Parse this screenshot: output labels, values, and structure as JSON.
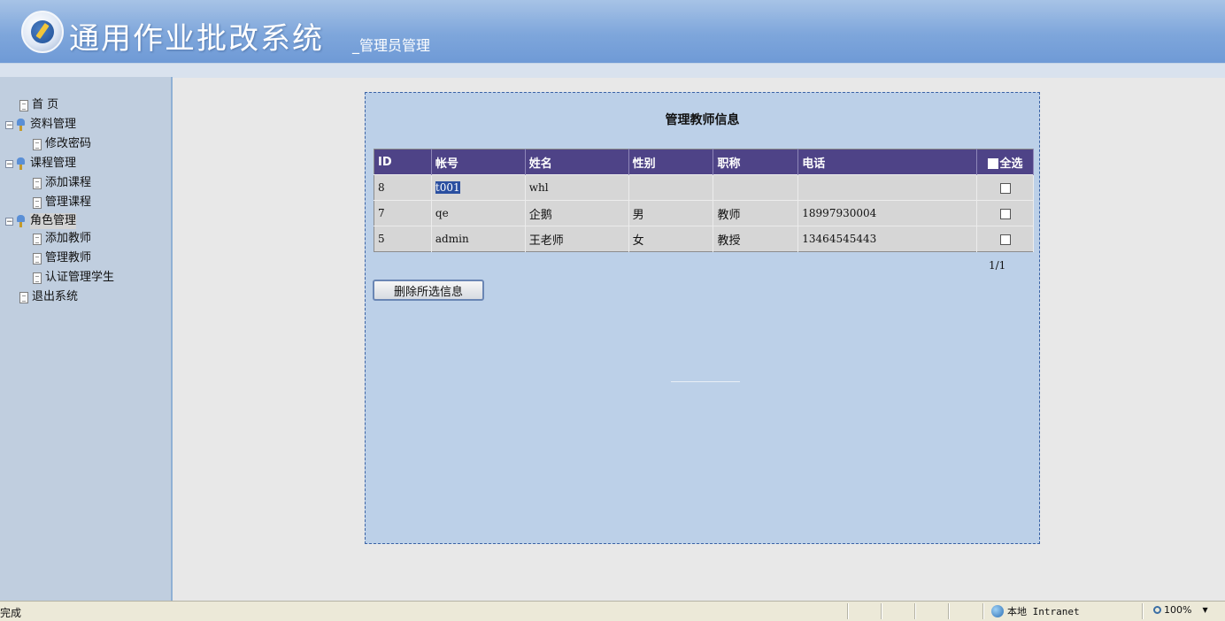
{
  "header": {
    "title": "通用作业批改系统",
    "subtitle": "_管理员管理"
  },
  "sidebar": {
    "items": [
      {
        "label": "首 页",
        "icon": "page-icon",
        "level": 0,
        "expander": ""
      },
      {
        "label": "资料管理",
        "icon": "folder-icon",
        "level": 0,
        "expander": "−"
      },
      {
        "label": "修改密码",
        "icon": "page-icon",
        "level": 1
      },
      {
        "label": "课程管理",
        "icon": "folder-icon",
        "level": 0,
        "expander": "−"
      },
      {
        "label": "添加课程",
        "icon": "page-icon",
        "level": 1
      },
      {
        "label": "管理课程",
        "icon": "page-icon",
        "level": 1
      },
      {
        "label": "角色管理",
        "icon": "folder-icon",
        "level": 0,
        "expander": "−",
        "selected": true
      },
      {
        "label": "添加教师",
        "icon": "page-icon",
        "level": 1
      },
      {
        "label": "管理教师",
        "icon": "page-icon",
        "level": 1
      },
      {
        "label": "认证管理学生",
        "icon": "page-icon",
        "level": 1
      },
      {
        "label": "退出系统",
        "icon": "page-icon",
        "level": 0
      }
    ]
  },
  "main": {
    "title": "管理教师信息",
    "columns": [
      "ID",
      "帐号",
      "姓名",
      "性别",
      "职称",
      "电话"
    ],
    "select_all_label": "全选",
    "rows": [
      {
        "id": "8",
        "account": "t001",
        "name": "whl",
        "gender": "",
        "title": "",
        "phone": ""
      },
      {
        "id": "7",
        "account": "qe",
        "name": "企鹅",
        "gender": "男",
        "title": "教师",
        "phone": "18997930004"
      },
      {
        "id": "5",
        "account": "admin",
        "name": "王老师",
        "gender": "女",
        "title": "教授",
        "phone": "13464545443"
      }
    ],
    "pager": "1/1",
    "delete_button": "删除所选信息"
  },
  "statusbar": {
    "status": "完成",
    "zone": "本地 Intranet",
    "zoom": "100%"
  }
}
